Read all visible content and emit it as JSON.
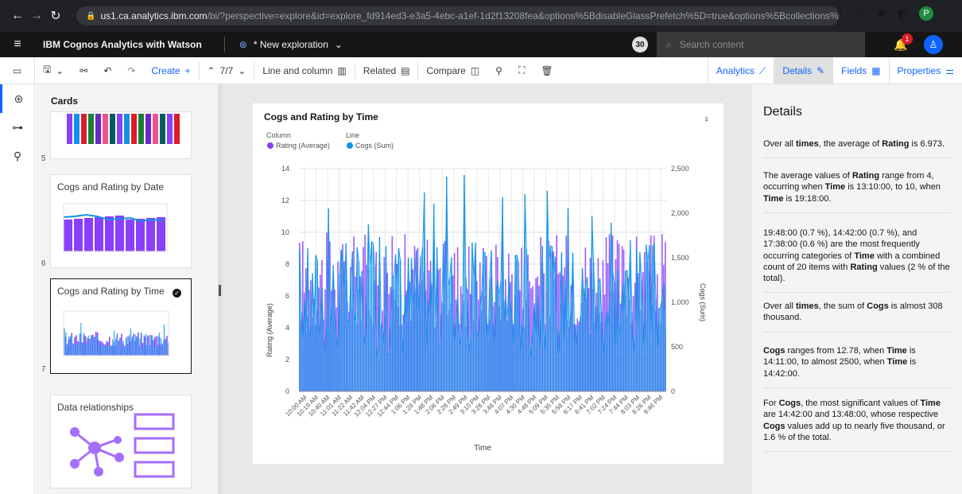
{
  "browser": {
    "url_host": "us1.ca.analytics.ibm.com",
    "url_rest": "/bi/?perspective=explore&id=explore_fd914ed3-e3a5-4ebc-a1ef-1d2f13208fea&options%5BdisableGlassPrefetch%5D=true&options%5Bcollections%5D%5BcanvasE...",
    "profile_letter": "P"
  },
  "app": {
    "title_bold": "IBM Cognos Analytics",
    "title_rest": " with Watson",
    "exploration": "* New exploration",
    "badge_count": "30",
    "search_placeholder": "Search content",
    "notification_count": "1"
  },
  "toolbar": {
    "create": "Create",
    "counter": "7/7",
    "viz_type": "Line and column",
    "related": "Related",
    "compare": "Compare",
    "analytics": "Analytics",
    "details": "Details",
    "fields": "Fields",
    "properties": "Properties"
  },
  "cards": {
    "heading": "Cards",
    "items": [
      {
        "number": "5",
        "title": ""
      },
      {
        "number": "6",
        "title": "Cogs and Rating by Date"
      },
      {
        "number": "7",
        "title": "Cogs and Rating by Time"
      },
      {
        "number": "",
        "title": "Data relationships"
      }
    ]
  },
  "chart_data": {
    "type": "bar",
    "title": "Cogs and Rating by Time",
    "legend": {
      "column_heading": "Column",
      "line_heading": "Line",
      "column_series": "Rating (Average)",
      "line_series": "Cogs (Sum)"
    },
    "xlabel": "Time",
    "ylabel_left": "Rating (Average)",
    "ylabel_right": "Cogs (Sum)",
    "y_left_ticks": [
      "0",
      "2",
      "4",
      "6",
      "8",
      "10",
      "12",
      "14"
    ],
    "y_right_ticks": [
      "0",
      "500",
      "1,000",
      "1,500",
      "2,000",
      "2,500"
    ],
    "ylim_left": [
      0,
      14
    ],
    "ylim_right": [
      0,
      2500
    ],
    "x_ticks": [
      "10:00 AM",
      "10:19 AM",
      "10:40 AM",
      "11:01 AM",
      "11:22 AM",
      "11:42 AM",
      "12:04 PM",
      "12:27 PM",
      "12:44 PM",
      "1:06 PM",
      "1:28 PM",
      "1:48 PM",
      "2:06 PM",
      "2:28 PM",
      "2:49 PM",
      "3:10 PM",
      "3:28 PM",
      "3:48 PM",
      "4:07 PM",
      "4:30 PM",
      "4:48 PM",
      "5:09 PM",
      "5:35 PM",
      "5:58 PM",
      "6:17 PM",
      "6:41 PM",
      "7:02 PM",
      "7:24 PM",
      "7:44 PM",
      "8:03 PM",
      "8:26 PM",
      "8:46 PM"
    ],
    "colors": {
      "column": "#8a3ffc",
      "line": "#1192e8"
    },
    "series_note": "506 time points; values range Rating 4–10, Cogs 12.78–2500"
  },
  "details": {
    "heading": "Details",
    "insights": [
      [
        {
          "t": "Over all "
        },
        {
          "t": "times",
          "b": true
        },
        {
          "t": ", the average of "
        },
        {
          "t": "Rating",
          "b": true
        },
        {
          "t": " is 6.973."
        }
      ],
      [
        {
          "t": "The average values of "
        },
        {
          "t": "Rating",
          "b": true
        },
        {
          "t": " range from 4, occurring when "
        },
        {
          "t": "Time",
          "b": true
        },
        {
          "t": " is 13:10:00, to 10, when "
        },
        {
          "t": "Time",
          "b": true
        },
        {
          "t": " is 19:18:00."
        }
      ],
      [
        {
          "t": "19:48:00 (0.7 %), 14:42:00 (0.7 %), and 17:38:00 (0.6 %) are the most frequently occurring categories of "
        },
        {
          "t": "Time",
          "b": true
        },
        {
          "t": " with a combined count of 20 items with "
        },
        {
          "t": "Rating",
          "b": true
        },
        {
          "t": " values (2 % of the total)."
        }
      ],
      [
        {
          "t": "Over all "
        },
        {
          "t": "times",
          "b": true
        },
        {
          "t": ", the sum of "
        },
        {
          "t": "Cogs",
          "b": true
        },
        {
          "t": " is almost 308 thousand."
        }
      ],
      [
        {
          "t": "Cogs",
          "b": true
        },
        {
          "t": " ranges from 12.78, when "
        },
        {
          "t": "Time",
          "b": true
        },
        {
          "t": " is 14:11:00, to almost 2500, when "
        },
        {
          "t": "Time",
          "b": true
        },
        {
          "t": " is 14:42:00."
        }
      ],
      [
        {
          "t": "For "
        },
        {
          "t": "Cogs",
          "b": true
        },
        {
          "t": ", the most significant values of "
        },
        {
          "t": "Time",
          "b": true
        },
        {
          "t": " are 14:42:00 and 13:48:00, whose respective "
        },
        {
          "t": "Cogs",
          "b": true
        },
        {
          "t": " values add up to nearly five thousand, or 1.6 % of the total."
        }
      ]
    ]
  }
}
